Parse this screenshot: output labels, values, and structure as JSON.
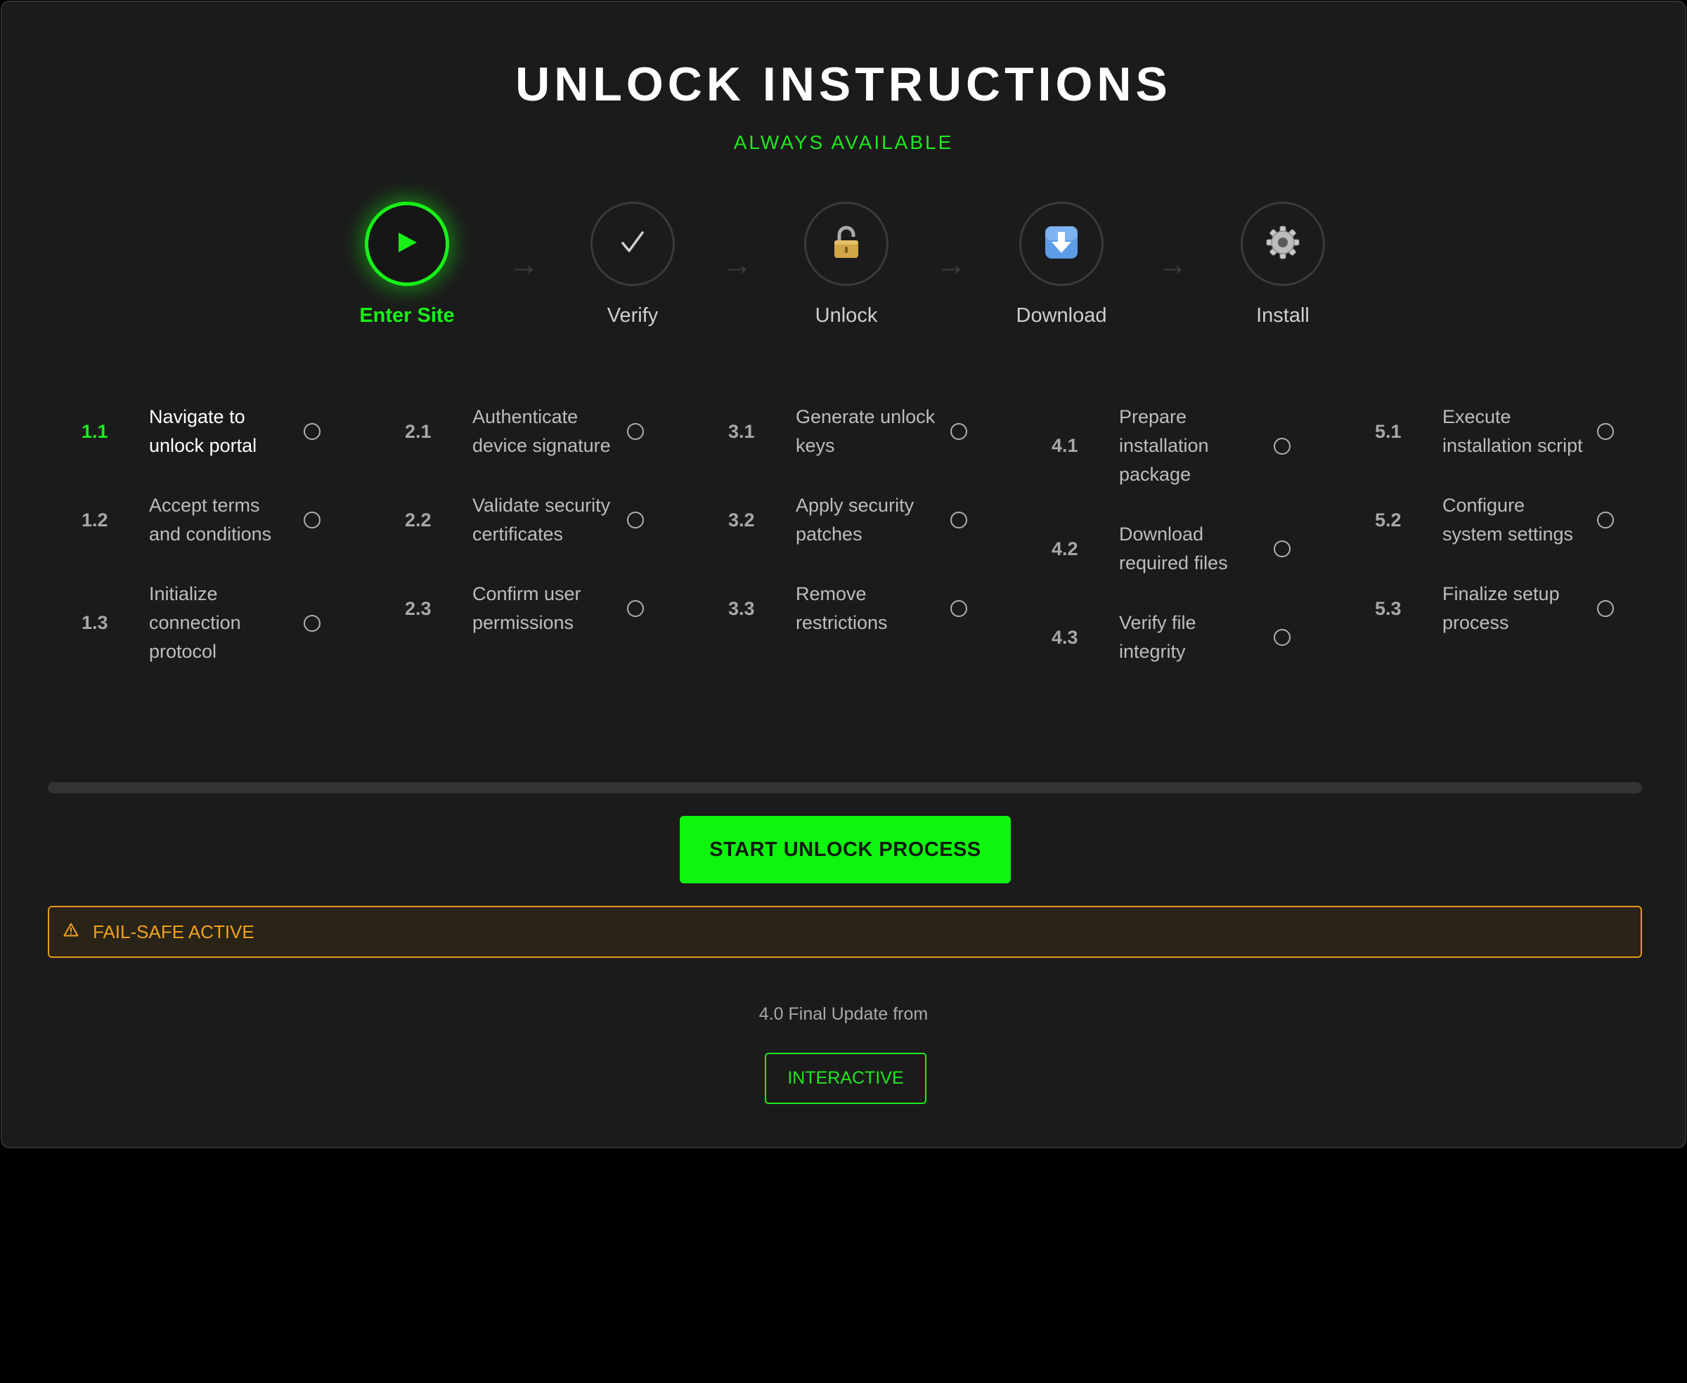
{
  "header": {
    "title": "UNLOCK INSTRUCTIONS",
    "subtitle": "ALWAYS AVAILABLE"
  },
  "steps": [
    {
      "label": "Enter Site",
      "icon": "play-icon",
      "active": true
    },
    {
      "label": "Verify",
      "icon": "checkmark-icon",
      "active": false
    },
    {
      "label": "Unlock",
      "icon": "padlock-icon",
      "active": false
    },
    {
      "label": "Download",
      "icon": "download-icon",
      "active": false
    },
    {
      "label": "Install",
      "icon": "gear-icon",
      "active": false
    }
  ],
  "arrow_glyph": "→",
  "tasks": [
    [
      {
        "num": "1.1",
        "text": "Navigate to unlock portal"
      },
      {
        "num": "1.2",
        "text": "Accept terms and conditions"
      },
      {
        "num": "1.3",
        "text": "Initialize connection protocol"
      }
    ],
    [
      {
        "num": "2.1",
        "text": "Authenticate device signature"
      },
      {
        "num": "2.2",
        "text": "Validate security certificates"
      },
      {
        "num": "2.3",
        "text": "Confirm user permissions"
      }
    ],
    [
      {
        "num": "3.1",
        "text": "Generate unlock keys"
      },
      {
        "num": "3.2",
        "text": "Apply security patches"
      },
      {
        "num": "3.3",
        "text": "Remove restrictions"
      }
    ],
    [
      {
        "num": "4.1",
        "text": "Prepare installation package"
      },
      {
        "num": "4.2",
        "text": "Download required files"
      },
      {
        "num": "4.3",
        "text": "Verify file integrity"
      }
    ],
    [
      {
        "num": "5.1",
        "text": "Execute installation script"
      },
      {
        "num": "5.2",
        "text": "Configure system settings"
      },
      {
        "num": "5.3",
        "text": "Finalize setup process"
      }
    ]
  ],
  "progress": 0,
  "start_button": "START UNLOCK PROCESS",
  "failsafe": {
    "icon": "warning-icon",
    "text": "FAIL-SAFE ACTIVE"
  },
  "footer": {
    "version": "4.0 Final Update from",
    "interactive_button": "INTERACTIVE"
  },
  "colors": {
    "accent": "#17f217",
    "warning": "#f0a21b",
    "background": "#1b1b1b"
  }
}
